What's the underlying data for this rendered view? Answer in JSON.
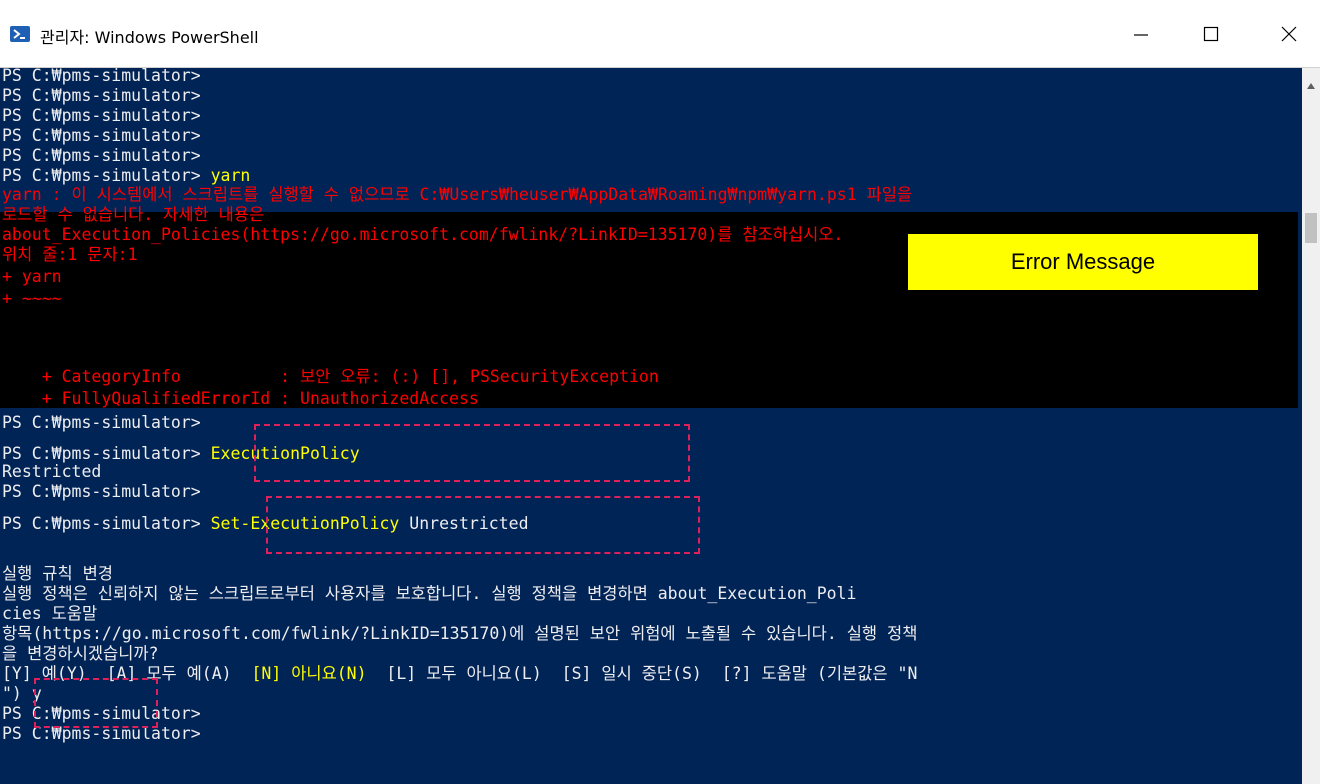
{
  "window": {
    "title": "관리자: Windows PowerShell",
    "icon": "powershell-icon",
    "controls": {
      "minimize": "minimize-icon",
      "maximize": "maximize-icon",
      "close": "close-icon"
    }
  },
  "console": {
    "prompt_lines": [
      "PS C:₩pms-simulator>",
      "PS C:₩pms-simulator>",
      "PS C:₩pms-simulator>",
      "PS C:₩pms-simulator>",
      "PS C:₩pms-simulator>"
    ],
    "yarn_prompt": "PS C:₩pms-simulator> ",
    "yarn_cmd": "yarn",
    "error_lines": [
      "yarn : 이 시스템에서 스크립트를 실행할 수 없으므로 C:₩Users₩heuser₩AppData₩Roaming₩npm₩yarn.ps1 파일을",
      "로드할 수 없습니다. 자세한 내용은",
      "about_Execution_Policies(https://go.microsoft.com/fwlink/?LinkID=135170)를 참조하십시오.",
      "위치 줄:1 문자:1",
      "+ yarn",
      "+ ~~~~",
      "    + CategoryInfo          : 보안 오류: (:) [], PSSecurityException",
      "    + FullyQualifiedErrorId : UnauthorizedAccess"
    ],
    "after_error_prompt": "PS C:₩pms-simulator>",
    "get_policy_prompt": "PS C:₩pms-simulator> ",
    "get_policy_cmd": "ExecutionPolicy",
    "get_policy_result": "Restricted",
    "prompt_after_result": "PS C:₩pms-simulator>",
    "set_policy_prompt": "PS C:₩pms-simulator> ",
    "set_policy_cmd": "Set-ExecutionPolicy",
    "set_policy_arg": " Unrestricted",
    "confirm_lines": [
      "실행 규칙 변경",
      "실행 정책은 신뢰하지 않는 스크립트로부터 사용자를 보호합니다. 실행 정책을 변경하면 about_Execution_Poli",
      "cies 도움말",
      "항목(https://go.microsoft.com/fwlink/?LinkID=135170)에 설명된 보안 위험에 노출될 수 있습니다. 실행 정책",
      "을 변경하시겠습니까?"
    ],
    "choice_part1": "[Y] 예(Y)  [A] 모두 예(A)  ",
    "choice_default": "[N] 아니요(N)",
    "choice_part2": "  [L] 모두 아니요(L)  [S] 일시 중단(S)  [?] 도움말 (기본값은 \"N",
    "answer_prefix": "\") ",
    "answer": "y",
    "final_prompts": [
      "PS C:₩pms-simulator>",
      "PS C:₩pms-simulator>"
    ]
  },
  "annotation": {
    "error_label": "Error Message"
  },
  "colors": {
    "console_bg": "#012456",
    "error_bg": "#000000",
    "error_text": "#ff0000",
    "command_text": "#ffff00",
    "default_text": "#eeedf0",
    "highlight_box": "#e0205a",
    "label_bg": "#ffff00"
  }
}
